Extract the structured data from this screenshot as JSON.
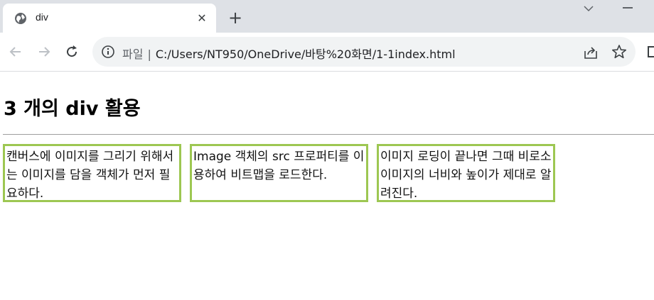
{
  "browser": {
    "tab": {
      "title": "div",
      "icon": "globe-icon"
    },
    "new_tab_icon": "plus-icon",
    "address_bar": {
      "scheme_label": "파일",
      "separator": "|",
      "url": "C:/Users/NT950/OneDrive/바탕%20화면/1-1index.html"
    },
    "colors": {
      "tabstrip": "#dee1e6",
      "omnibox": "#f1f3f4"
    }
  },
  "page": {
    "heading": "3 개의 div 활용",
    "cards": [
      {
        "text": "캔버스에 이미지를 그리기 위해서는 이미지를 담을 객체가 먼저 필요하다."
      },
      {
        "text": "Image 객체의 src 프로퍼티를 이용하여 비트맵을 로드한다."
      },
      {
        "text": "이미지 로딩이 끝나면 그때 비로소 이미지의 너비와 높이가 제대로 알려진다."
      }
    ],
    "colors": {
      "card_border": "#9dc752",
      "rule": "#9e9e9e"
    }
  }
}
